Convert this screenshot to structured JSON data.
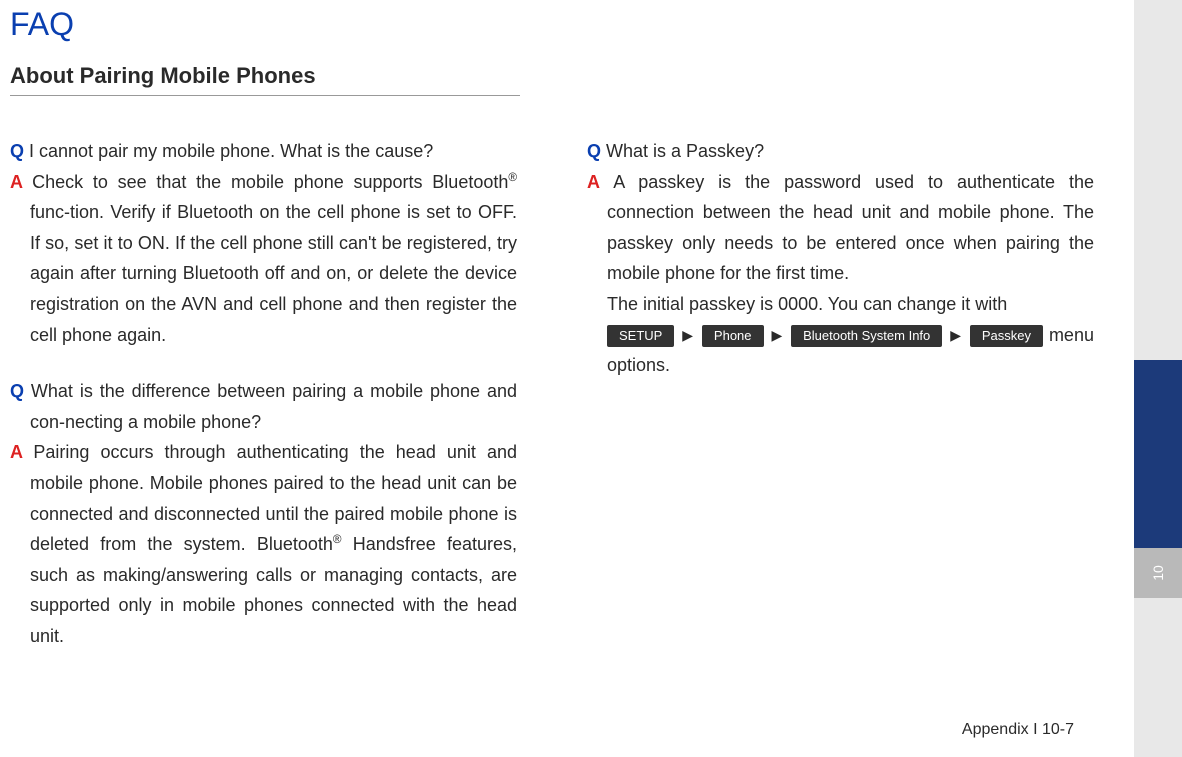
{
  "title": "FAQ",
  "section": "About Pairing Mobile Phones",
  "sidebar_tab": "10",
  "col1": {
    "q1": "I cannot pair my mobile phone. What is the cause?",
    "a1_p1": "Check to see that the mobile phone supports Bluetooth",
    "a1_p2": " func-tion. Verify if Bluetooth on the cell phone is set to OFF. If so, set it to ON. If the cell phone still can't be registered, try again after turning Bluetooth off and on, or delete the device registration on the AVN and cell phone and then register the cell phone again.",
    "q2": "What is the difference between pairing a mobile phone and con-necting a mobile phone?",
    "a2_p1": "Pairing occurs through authenticating the head unit and mobile phone. Mobile phones paired to the head unit can be connected and disconnected until the paired mobile phone is deleted from the system. Bluetooth",
    "a2_p2": " Handsfree features, such as making/answering calls or managing contacts, are supported only in mobile phones connected with the head unit."
  },
  "col2": {
    "q3": "What is a Passkey?",
    "a3_p1": "A passkey is the password used to authenticate the connection between the head unit and mobile phone. The passkey only needs to be entered once when pairing the mobile phone for the first time.",
    "a3_p2": "The initial passkey is 0000. You can change it with",
    "a3_p3": "menu options.",
    "btn_setup": "SETUP",
    "btn_phone": "Phone",
    "btn_bt": "Bluetooth System Info",
    "btn_passkey": "Passkey"
  },
  "reg": "®",
  "arrow": "▶",
  "footer": "Appendix I 10-7"
}
